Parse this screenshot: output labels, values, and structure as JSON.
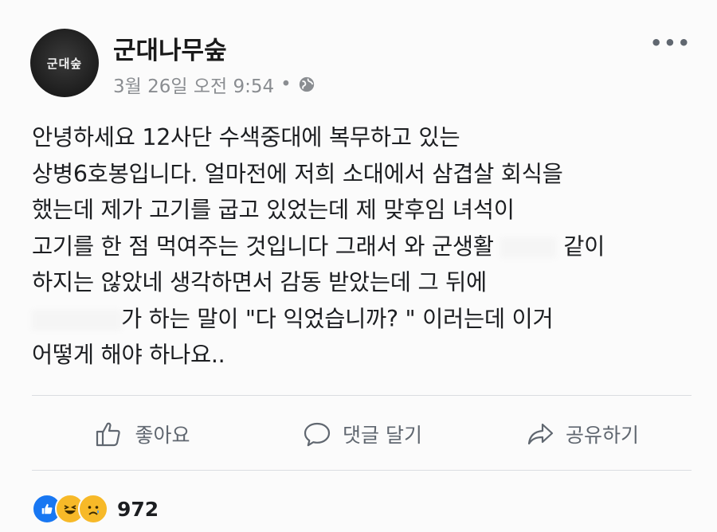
{
  "post": {
    "avatar_text": "군대숲",
    "page_name": "군대나무숲",
    "timestamp": "3월 26일 오전 9:54",
    "separator": "•",
    "more_label": "•••",
    "body_lines": [
      "안녕하세요 12사단 수색중대에 복무하고 있는",
      "상병6호봉입니다. 얼마전에 저희 소대에서 삼겹살 회식을",
      "했는데 제가 고기를 굽고 있었는데 제 맞후임 녀석이",
      "고기를 한 점 먹여주는 것입니다 그래서 와 군생활",
      "같이",
      "하지는 않았네 생각하면서 감동 받았는데 그 뒤에",
      "가 하는 말이 \"다 익었습니까? \" 이러는데 이거",
      "어떻게 해야 하나요.."
    ]
  },
  "actions": {
    "like": "좋아요",
    "comment": "댓글 달기",
    "share": "공유하기"
  },
  "reactions": {
    "count": "972",
    "types": [
      "like-icon",
      "haha-icon",
      "sad-icon"
    ]
  },
  "colors": {
    "like_blue": "#1877f2",
    "emoji_yellow": "#f7b928",
    "muted_gray": "#606770"
  }
}
